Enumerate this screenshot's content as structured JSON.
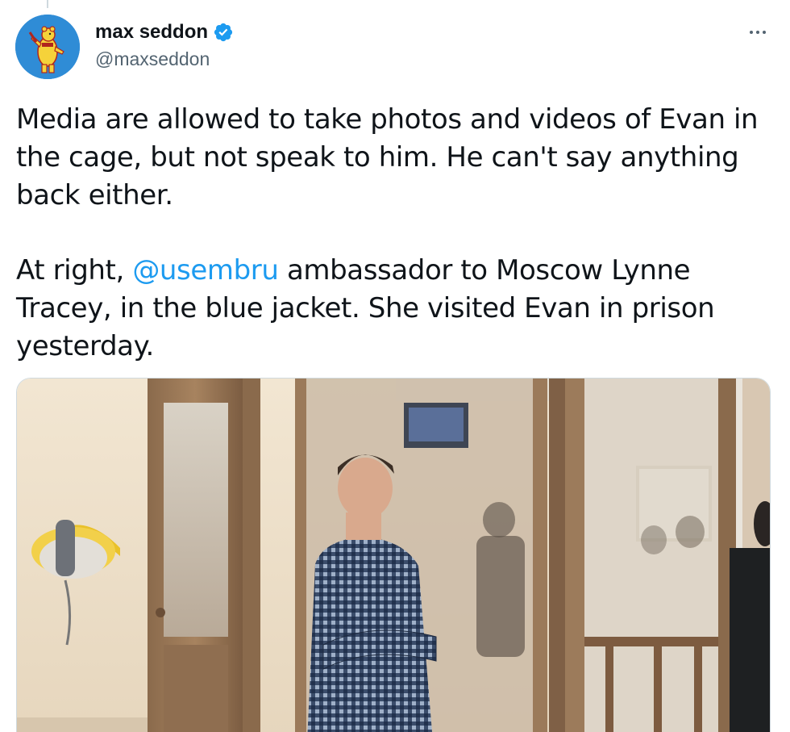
{
  "author": {
    "display_name": "max seddon",
    "handle": "@maxseddon",
    "verified": true,
    "avatar_icon": "bear-avatar-icon",
    "verified_color": "#1d9bf0"
  },
  "tweet": {
    "paragraph1": "Media are allowed to take photos and videos of Evan in the cage, but not speak to him. He can't say anything back either.",
    "paragraph2_before": "At right, ",
    "mention": "@usembru",
    "paragraph2_after": " ambassador to Moscow Lynne Tracey, in the blue jacket. She visited Evan in prison yesterday."
  },
  "menu": {
    "more_icon": "more-options-icon"
  },
  "colors": {
    "link": "#1d9bf0",
    "text": "#0f1419",
    "secondary": "#536471"
  }
}
